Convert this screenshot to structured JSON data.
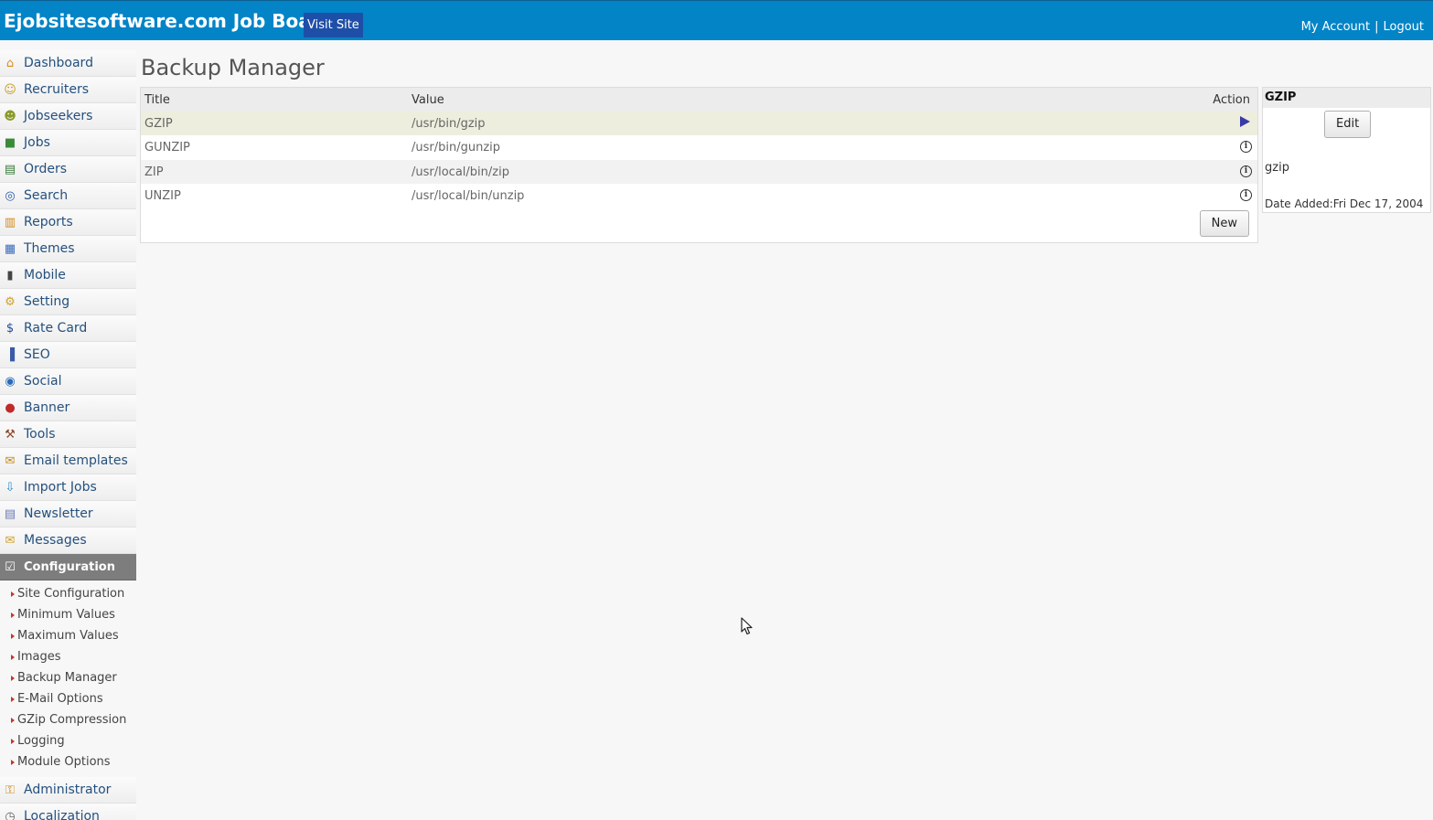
{
  "header": {
    "brand": "Ejobsitesoftware.com Job Board",
    "visit_site": "Visit Site",
    "my_account": "My Account",
    "separator": "|",
    "logout": "Logout",
    "bg_color": "#0284c7"
  },
  "sidebar": {
    "items": [
      {
        "label": "Dashboard",
        "icon": "home-icon"
      },
      {
        "label": "Recruiters",
        "icon": "recruiter-icon"
      },
      {
        "label": "Jobseekers",
        "icon": "jobseekers-icon"
      },
      {
        "label": "Jobs",
        "icon": "jobs-icon"
      },
      {
        "label": "Orders",
        "icon": "orders-icon"
      },
      {
        "label": "Search",
        "icon": "search-icon"
      },
      {
        "label": "Reports",
        "icon": "reports-icon"
      },
      {
        "label": "Themes",
        "icon": "themes-icon"
      },
      {
        "label": "Mobile",
        "icon": "mobile-icon"
      },
      {
        "label": "Setting",
        "icon": "gear-icon"
      },
      {
        "label": "Rate Card",
        "icon": "dollar-icon"
      },
      {
        "label": "SEO",
        "icon": "seo-chart-icon"
      },
      {
        "label": "Social",
        "icon": "social-icon"
      },
      {
        "label": "Banner",
        "icon": "banner-icon"
      },
      {
        "label": "Tools",
        "icon": "tools-icon"
      },
      {
        "label": "Email templates",
        "icon": "email-icon"
      },
      {
        "label": "Import Jobs",
        "icon": "import-icon"
      },
      {
        "label": "Newsletter",
        "icon": "newsletter-icon"
      },
      {
        "label": "Messages",
        "icon": "messages-icon"
      },
      {
        "label": "Configuration",
        "icon": "configuration-icon"
      }
    ],
    "config_sub": [
      "Site Configuration",
      "Minimum Values",
      "Maximum Values",
      "Images",
      "Backup Manager",
      "E-Mail Options",
      "GZip Compression",
      "Logging",
      "Module Options"
    ],
    "after_items": [
      {
        "label": "Administrator",
        "icon": "administrator-icon"
      },
      {
        "label": "Localization",
        "icon": "clock-icon"
      }
    ]
  },
  "main": {
    "title": "Backup Manager",
    "table": {
      "headers": {
        "title": "Title",
        "value": "Value",
        "action": "Action"
      },
      "rows": [
        {
          "title": "GZIP",
          "value": "/usr/bin/gzip",
          "action_icon": "play-arrow-icon",
          "selected": true
        },
        {
          "title": "GUNZIP",
          "value": "/usr/bin/gunzip",
          "action_icon": "info-icon",
          "selected": false
        },
        {
          "title": "ZIP",
          "value": "/usr/local/bin/zip",
          "action_icon": "info-icon",
          "selected": false
        },
        {
          "title": "UNZIP",
          "value": "/usr/local/bin/unzip",
          "action_icon": "info-icon",
          "selected": false
        }
      ],
      "info_glyph": "i"
    },
    "new_button": "New"
  },
  "detail": {
    "heading": "GZIP",
    "edit_button": "Edit",
    "value": "gzip",
    "date_added": "Date Added:Fri Dec 17, 2004"
  }
}
